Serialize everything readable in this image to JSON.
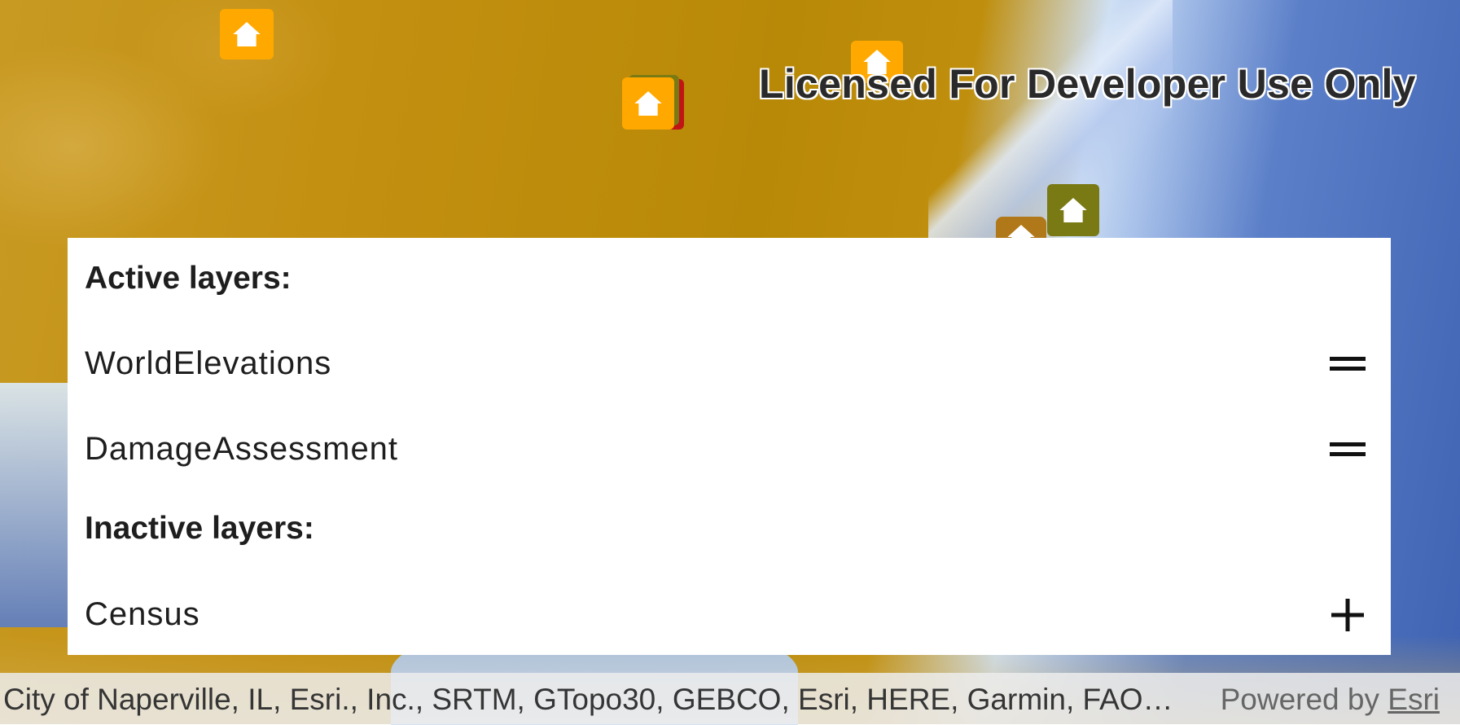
{
  "map": {
    "license_text": "Licensed For Developer Use Only",
    "marker_icon": "house-icon",
    "colors": {
      "elevation_land": "#c38f10",
      "ocean": "#3f63b2",
      "marker_orange": "#ffa800",
      "marker_olive": "#7a7a14",
      "marker_red": "#c01515",
      "marker_brown": "#b07818"
    }
  },
  "layers_panel": {
    "active_title": "Active layers:",
    "active_layers": [
      {
        "label": "WorldElevations",
        "action_icon": "drag-handle-icon"
      },
      {
        "label": "DamageAssessment",
        "action_icon": "drag-handle-icon"
      }
    ],
    "inactive_title": "Inactive layers:",
    "inactive_layers": [
      {
        "label": "Census",
        "action_icon": "plus-icon"
      }
    ]
  },
  "attribution": {
    "text": "City of Naperville, IL, Esri., Inc., SRTM, GTopo30, GEBCO, Esri, HERE, Garmin, FAO, N...",
    "powered_by": "Powered by",
    "esri_link": "Esri"
  }
}
